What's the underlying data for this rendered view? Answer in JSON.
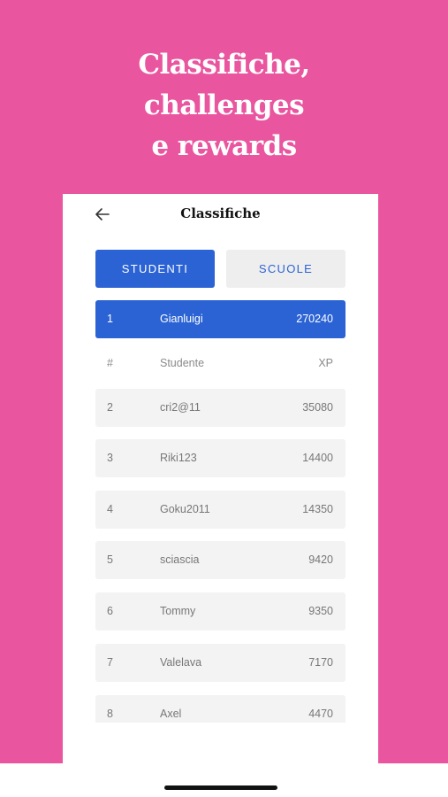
{
  "headline": {
    "line1": "Classifiche,",
    "line2": "challenges",
    "line3": "e rewards"
  },
  "screen": {
    "title": "Classifiche",
    "back_icon": "arrow-left-icon"
  },
  "tabs": [
    {
      "label": "STUDENTI",
      "active": true
    },
    {
      "label": "SCUOLE",
      "active": false
    }
  ],
  "current_user": {
    "rank": "1",
    "name": "Gianluigi",
    "xp": "270240"
  },
  "table_header": {
    "rank": "#",
    "name": "Studente",
    "xp": "XP"
  },
  "rows": [
    {
      "rank": "2",
      "name": "cri2@11",
      "xp": "35080"
    },
    {
      "rank": "3",
      "name": "Riki123",
      "xp": "14400"
    },
    {
      "rank": "4",
      "name": "Goku2011",
      "xp": "14350"
    },
    {
      "rank": "5",
      "name": "sciascia",
      "xp": "9420"
    },
    {
      "rank": "6",
      "name": "Tommy",
      "xp": "9350"
    },
    {
      "rank": "7",
      "name": "Valelava",
      "xp": "7170"
    },
    {
      "rank": "8",
      "name": "Axel",
      "xp": "4470"
    }
  ],
  "colors": {
    "promo_background": "#e9559f",
    "accent_blue": "#2b63d4",
    "row_background": "#f3f3f3"
  }
}
